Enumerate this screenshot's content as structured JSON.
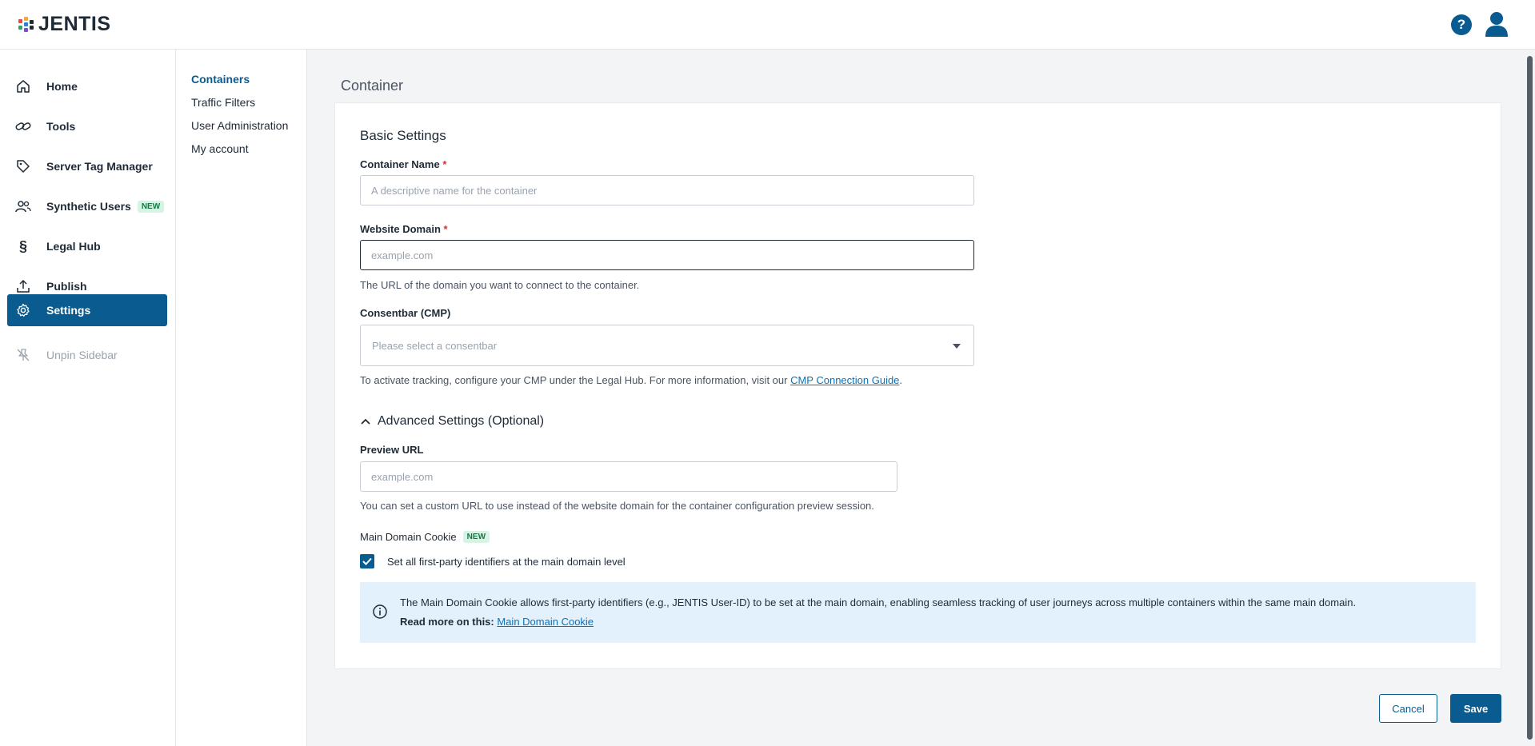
{
  "header": {
    "logo_text": "JENTIS",
    "help_label": "?"
  },
  "sidebar": {
    "items": [
      {
        "label": "Home",
        "icon": "home-icon"
      },
      {
        "label": "Tools",
        "icon": "link-icon"
      },
      {
        "label": "Server Tag Manager",
        "icon": "tag-icon"
      },
      {
        "label": "Synthetic Users",
        "icon": "users-icon",
        "badge": "NEW"
      },
      {
        "label": "Legal Hub",
        "icon": "section-sign-icon"
      },
      {
        "label": "Publish",
        "icon": "upload-icon"
      },
      {
        "label": "Settings",
        "icon": "gear-icon",
        "active": true
      },
      {
        "label": "Unpin Sidebar",
        "icon": "unpin-icon"
      }
    ]
  },
  "subnav": {
    "items": [
      "Containers",
      "Traffic Filters",
      "User Administration",
      "My account"
    ]
  },
  "main": {
    "title": "Container",
    "section_title": "Basic Settings",
    "container_name": {
      "label": "Container Name",
      "required": "*",
      "placeholder": "A descriptive name for the container",
      "value": ""
    },
    "website_domain": {
      "label": "Website Domain",
      "required": "*",
      "placeholder": "example.com",
      "value": "",
      "help": "The URL of the domain you want to connect to the container."
    },
    "consentbar": {
      "label": "Consentbar (CMP)",
      "placeholder": "Please select a consentbar",
      "help_prefix": "To activate tracking, configure your CMP under the Legal Hub. For more information, visit our ",
      "help_link": "CMP Connection Guide",
      "help_suffix": "."
    },
    "advanced": {
      "toggle_label": "Advanced Settings (Optional)",
      "preview_url": {
        "label": "Preview URL",
        "placeholder": "example.com",
        "help": "You can set a custom URL to use instead of the website domain for the container configuration preview session."
      },
      "main_domain_cookie": {
        "label": "Main Domain Cookie",
        "badge": "NEW",
        "checkbox_label": "Set all first-party identifiers at the main domain level",
        "checked": true
      },
      "info": {
        "text": "The Main Domain Cookie allows first-party identifiers (e.g., JENTIS User-ID) to be set at the main domain, enabling seamless tracking of user journeys across multiple containers within the same main domain.",
        "read_more_label": "Read more on this:",
        "read_more_link": "Main Domain Cookie"
      }
    }
  },
  "actions": {
    "cancel": "Cancel",
    "save": "Save"
  },
  "colors": {
    "brand": "#0a5b8f",
    "link": "#0a72b8",
    "info_bg": "#e3f1fc",
    "badge_bg": "#d6f3e3"
  }
}
